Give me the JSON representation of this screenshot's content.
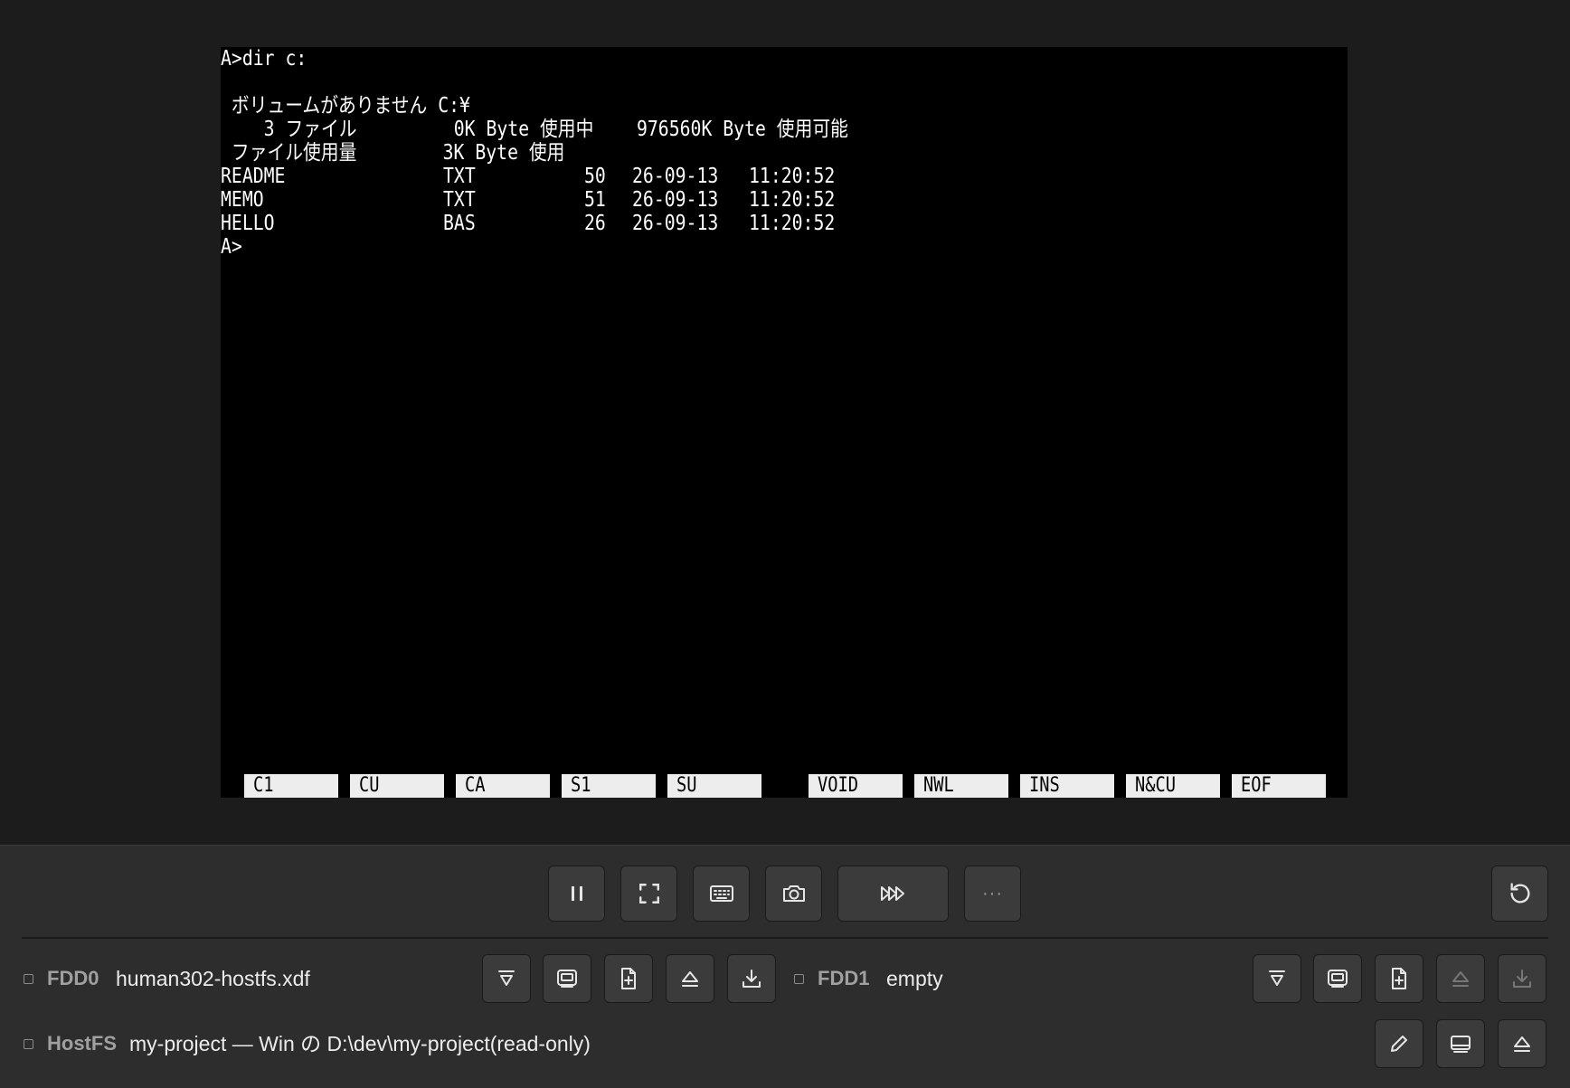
{
  "terminal": {
    "lines": [
      "A>dir c:",
      "",
      " ボリュームがありません C:¥",
      "    3 ファイル         0K Byte 使用中    976560K Byte 使用可能",
      " ファイル使用量        3K Byte 使用",
      "",
      "",
      "",
      "A>"
    ],
    "files": [
      {
        "name": "README",
        "ext": "TXT",
        "size": "50",
        "date": "26-09-13",
        "time": "11:20:52"
      },
      {
        "name": "MEMO",
        "ext": "TXT",
        "size": "51",
        "date": "26-09-13",
        "time": "11:20:52"
      },
      {
        "name": "HELLO",
        "ext": "BAS",
        "size": "26",
        "date": "26-09-13",
        "time": "11:20:52"
      }
    ],
    "function_keys": [
      "C1",
      "CU",
      "CA",
      "S1",
      "SU",
      "VOID",
      "NWL",
      "INS",
      "N&CU",
      "EOF"
    ]
  },
  "toolbar": {
    "icons": [
      "pause-icon",
      "fullscreen-icon",
      "keyboard-icon",
      "camera-icon",
      "fast-forward-icon",
      "more-icon",
      "reset-icon"
    ],
    "more_label": "···"
  },
  "drives": {
    "fdd0": {
      "label": "FDD0",
      "value": "human302-hostfs.xdf"
    },
    "fdd1": {
      "label": "FDD1",
      "value": "empty"
    },
    "hostfs": {
      "label": "HostFS",
      "value": "my-project — Win の D:\\dev\\my-project(read-only)"
    }
  },
  "colors": {
    "background": "#1c1c1c",
    "panel": "#2d2d2d",
    "button": "#3b3b3b",
    "screen": "#000000",
    "function_key": "#ededed"
  }
}
